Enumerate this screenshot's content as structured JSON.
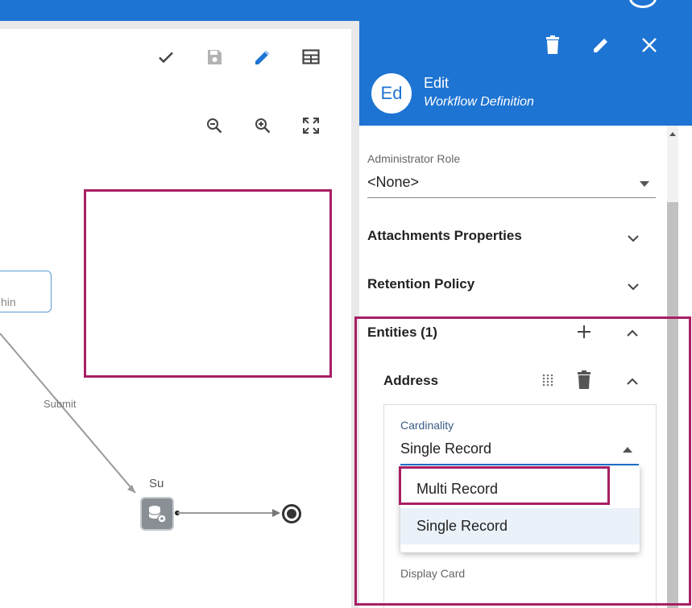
{
  "canvas": {
    "toolbar_icons": [
      "check-icon",
      "save-icon",
      "pencil-icon",
      "table-icon",
      "zoom-out-icon",
      "zoom-in-icon",
      "fit-screen-icon"
    ],
    "node_partial_label": "hin",
    "transition_label": "Submit",
    "task_label": "Su"
  },
  "panel": {
    "avatar_initials": "Ed",
    "title": "Edit",
    "subtitle": "Workflow Definition",
    "administrator_role": {
      "label": "Administrator Role",
      "value": "<None>"
    },
    "sections": {
      "attachments": "Attachments Properties",
      "retention": "Retention Policy",
      "entities": "Entities (1)"
    },
    "entity": {
      "name": "Address",
      "cardinality_label": "Cardinality",
      "cardinality_value": "Single Record",
      "options": [
        "Multi Record",
        "Single Record"
      ],
      "display_card_label": "Display Card"
    }
  },
  "colors": {
    "accent": "#1e74d2",
    "highlight": "#a81f63"
  }
}
